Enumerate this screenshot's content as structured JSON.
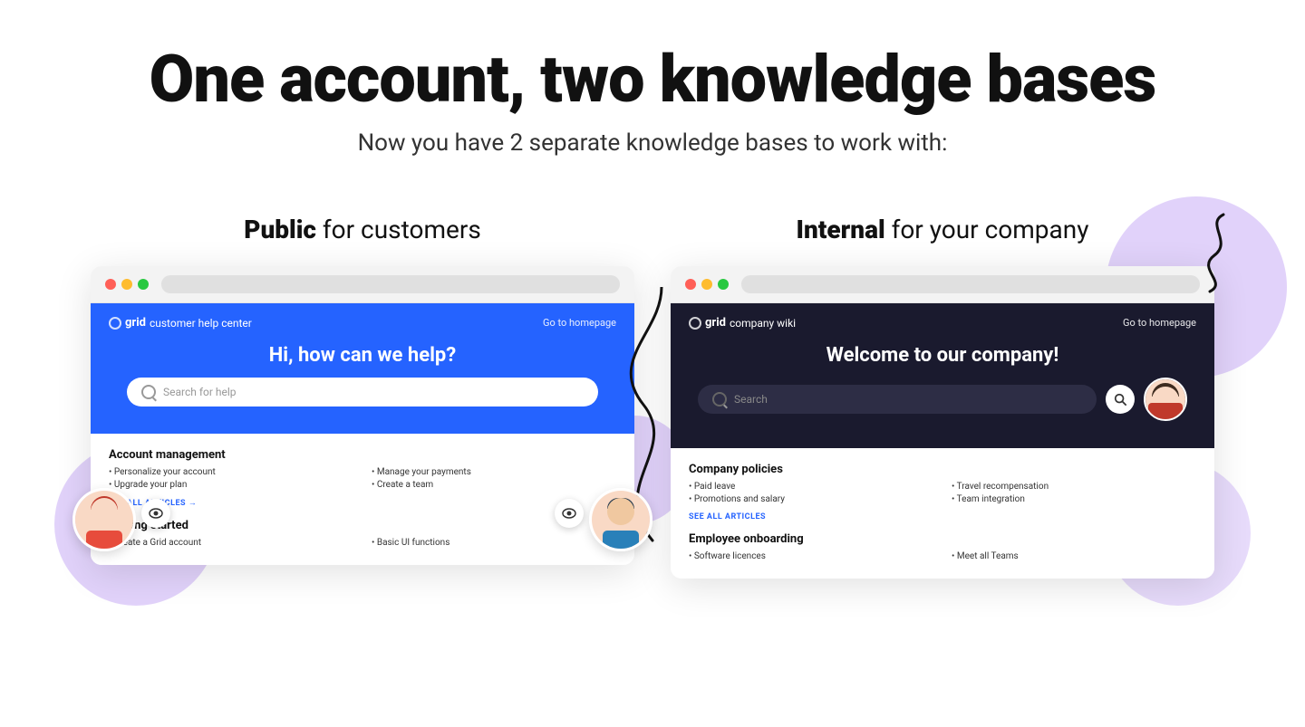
{
  "page": {
    "main_title": "One account, two knowledge bases",
    "subtitle": "Now you have 2 separate knowledge bases to work with:"
  },
  "public_kb": {
    "column_title_bold": "Public",
    "column_title_rest": " for customers",
    "brand_dot": "°",
    "brand_name": "grid",
    "brand_desc": "customer help center",
    "nav_link": "Go to homepage",
    "hero_title": "Hi, how can we help?",
    "search_placeholder": "Search for help",
    "sections": [
      {
        "title": "Account management",
        "col1_items": [
          "• Personalize your account",
          "• Upgrade your plan"
        ],
        "col2_items": [
          "• Manage your payments",
          "• Create a team"
        ],
        "see_all": "SEE ALL ARTICLES →"
      },
      {
        "title": "Getting started",
        "col1_items": [
          "• Create a Grid account"
        ],
        "col2_items": [
          "• Basic UI functions"
        ],
        "see_all": ""
      }
    ]
  },
  "internal_kb": {
    "column_title_bold": "Internal",
    "column_title_rest": " for your company",
    "brand_dot": "°",
    "brand_name": "grid",
    "brand_desc": "company wiki",
    "nav_link": "Go to homepage",
    "hero_title": "Welcome to our company!",
    "search_placeholder": "Search",
    "sections": [
      {
        "title": "Company policies",
        "col1_items": [
          "• Paid leave",
          "• Promotions and salary"
        ],
        "col2_items": [
          "• Travel recompensation",
          "• Team integration"
        ],
        "see_all": "SEE ALL ARTICLES"
      },
      {
        "title": "Employee onboarding",
        "col1_items": [
          "• Software licences"
        ],
        "col2_items": [
          "• Meet all Teams"
        ],
        "see_all": ""
      }
    ]
  }
}
